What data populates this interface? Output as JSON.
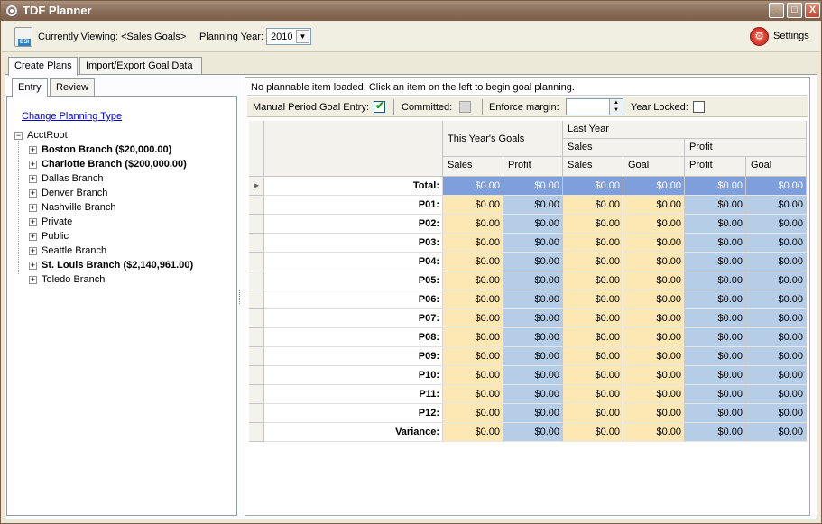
{
  "window": {
    "title": "TDF Planner",
    "controls": [
      "_",
      "□",
      "X"
    ]
  },
  "toolbar": {
    "viewing_text": "Currently Viewing: <Sales Goals>",
    "planning_year_label": "Planning Year:",
    "planning_year_value": "2010",
    "settings_label": "Settings",
    "bsi_badge": "BSI"
  },
  "tabs": [
    "Create Plans",
    "Import/Export Goal Data"
  ],
  "inner_tabs": [
    "Entry",
    "Review"
  ],
  "change_link": "Change Planning Type",
  "tree": {
    "root": "AcctRoot",
    "items": [
      {
        "label": "Boston Branch ($20,000.00)",
        "bold": true
      },
      {
        "label": "Charlotte Branch ($200,000.00)",
        "bold": true
      },
      {
        "label": "Dallas Branch",
        "bold": false
      },
      {
        "label": "Denver Branch",
        "bold": false
      },
      {
        "label": "Nashville Branch",
        "bold": false
      },
      {
        "label": "Private",
        "bold": false
      },
      {
        "label": "Public",
        "bold": false
      },
      {
        "label": "Seattle Branch",
        "bold": false
      },
      {
        "label": "St. Louis Branch ($2,140,961.00)",
        "bold": true
      },
      {
        "label": "Toledo Branch",
        "bold": false
      }
    ]
  },
  "message": "No plannable item loaded. Click an item on the left to begin goal planning.",
  "options": {
    "manual_label": "Manual Period Goal Entry:",
    "committed_label": "Committed:",
    "enforce_label": "Enforce margin:",
    "year_locked_label": "Year Locked:"
  },
  "grid": {
    "group_this_year": "This Year's Goals",
    "group_last_year": "Last Year",
    "sub_sales": "Sales",
    "sub_profit": "Profit",
    "columns": [
      "Sales",
      "Profit",
      "Sales",
      "Goal",
      "Profit",
      "Goal"
    ],
    "rows": [
      {
        "label": "Total:",
        "values": [
          "$0.00",
          "$0.00",
          "$0.00",
          "$0.00",
          "$0.00",
          "$0.00"
        ]
      },
      {
        "label": "P01:",
        "values": [
          "$0.00",
          "$0.00",
          "$0.00",
          "$0.00",
          "$0.00",
          "$0.00"
        ]
      },
      {
        "label": "P02:",
        "values": [
          "$0.00",
          "$0.00",
          "$0.00",
          "$0.00",
          "$0.00",
          "$0.00"
        ]
      },
      {
        "label": "P03:",
        "values": [
          "$0.00",
          "$0.00",
          "$0.00",
          "$0.00",
          "$0.00",
          "$0.00"
        ]
      },
      {
        "label": "P04:",
        "values": [
          "$0.00",
          "$0.00",
          "$0.00",
          "$0.00",
          "$0.00",
          "$0.00"
        ]
      },
      {
        "label": "P05:",
        "values": [
          "$0.00",
          "$0.00",
          "$0.00",
          "$0.00",
          "$0.00",
          "$0.00"
        ]
      },
      {
        "label": "P06:",
        "values": [
          "$0.00",
          "$0.00",
          "$0.00",
          "$0.00",
          "$0.00",
          "$0.00"
        ]
      },
      {
        "label": "P07:",
        "values": [
          "$0.00",
          "$0.00",
          "$0.00",
          "$0.00",
          "$0.00",
          "$0.00"
        ]
      },
      {
        "label": "P08:",
        "values": [
          "$0.00",
          "$0.00",
          "$0.00",
          "$0.00",
          "$0.00",
          "$0.00"
        ]
      },
      {
        "label": "P09:",
        "values": [
          "$0.00",
          "$0.00",
          "$0.00",
          "$0.00",
          "$0.00",
          "$0.00"
        ]
      },
      {
        "label": "P10:",
        "values": [
          "$0.00",
          "$0.00",
          "$0.00",
          "$0.00",
          "$0.00",
          "$0.00"
        ]
      },
      {
        "label": "P11:",
        "values": [
          "$0.00",
          "$0.00",
          "$0.00",
          "$0.00",
          "$0.00",
          "$0.00"
        ]
      },
      {
        "label": "P12:",
        "values": [
          "$0.00",
          "$0.00",
          "$0.00",
          "$0.00",
          "$0.00",
          "$0.00"
        ]
      },
      {
        "label": "Variance:",
        "values": [
          "$0.00",
          "$0.00",
          "$0.00",
          "$0.00",
          "$0.00",
          "$0.00"
        ]
      }
    ]
  },
  "colors": {
    "sales_cell": "#fde7b3",
    "profit_cell": "#b6cde8",
    "total_row": "#7f9fdc",
    "titlebar": "#8a6e5a"
  }
}
